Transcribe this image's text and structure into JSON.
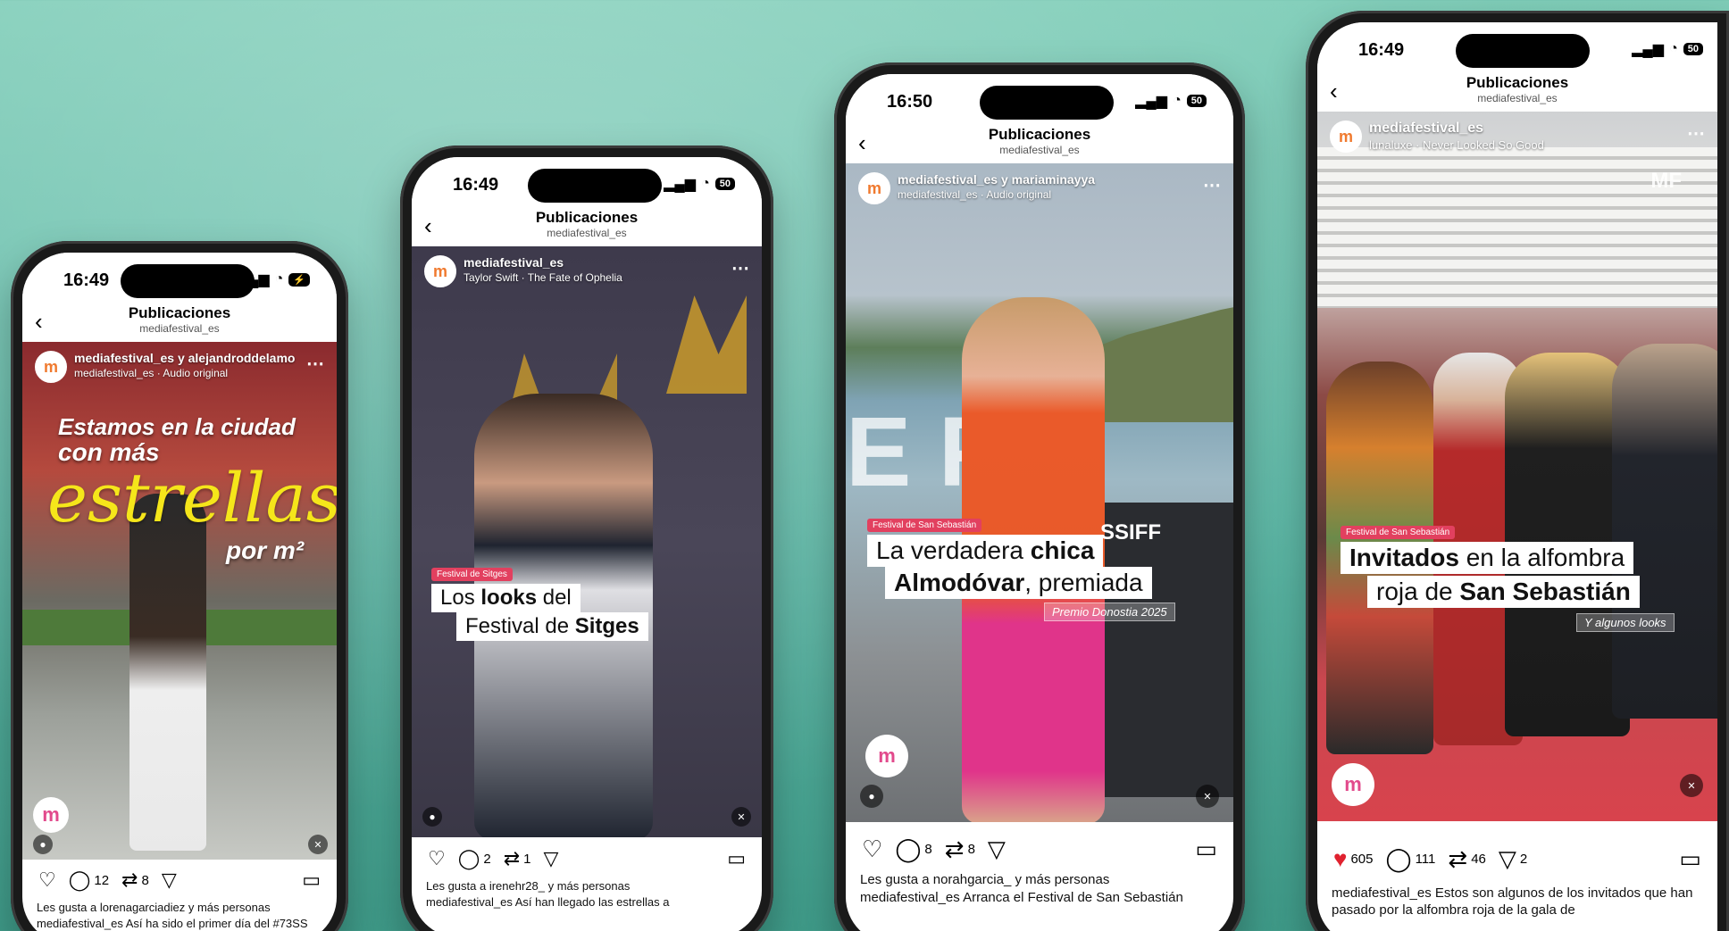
{
  "header_title": "Publicaciones",
  "header_sub": "mediafestival_es",
  "phones": [
    {
      "time": "16:49",
      "account": "mediafestival_es y alejandroddelamo",
      "audio": "mediafestival_es · Audio original",
      "caption_lines": [
        "Estamos en la ciudad",
        "con más",
        "estrellas",
        "por m²"
      ],
      "comments": "12",
      "reposts": "8",
      "likes_by": "Les gusta a lorenagarciadiez y más personas",
      "desc": "mediafestival_es Así ha sido el primer día del #73SS"
    },
    {
      "time": "16:49",
      "account": "mediafestival_es",
      "audio": "Taylor Swift · The Fate of Ophelia",
      "tag": "Festival de Sitges",
      "cap1_a": "Los ",
      "cap1_b": "looks",
      "cap1_c": " del",
      "cap2_a": "Festival de ",
      "cap2_b": "Sitges",
      "comments": "2",
      "reposts": "1",
      "likes_by": "Les gusta a irenehr28_ y más personas",
      "desc": "mediafestival_es Así han llegado las estrellas a"
    },
    {
      "time": "16:50",
      "account": "mediafestival_es y mariaminayya",
      "audio": "mediafestival_es · Audio original",
      "tag": "Festival de San Sebastián",
      "cap1_a": "La verdadera ",
      "cap1_b": "chica",
      "cap2_a": "Almodóvar",
      "cap2_b": ", premiada",
      "sub": "Premio Donostia 2025",
      "comments": "8",
      "reposts": "8",
      "likes_by": "Les gusta a norahgarcia_ y más personas",
      "desc": "mediafestival_es Arranca el Festival de San Sebastián"
    },
    {
      "time": "16:49",
      "account": "mediafestival_es",
      "audio": "lunaluxe · Never Looked So Good",
      "tag": "Festival de San Sebastián",
      "cap1_a": "Invitados",
      "cap1_b": " en la alfombra",
      "cap2_a": "roja de ",
      "cap2_b": "San Sebastián",
      "sub": "Y algunos looks",
      "likes": "605",
      "comments": "111",
      "reposts": "46",
      "shares": "2",
      "desc": "mediafestival_es Estos son algunos de los invitados que han pasado por la alfombra roja de la gala de"
    }
  ]
}
